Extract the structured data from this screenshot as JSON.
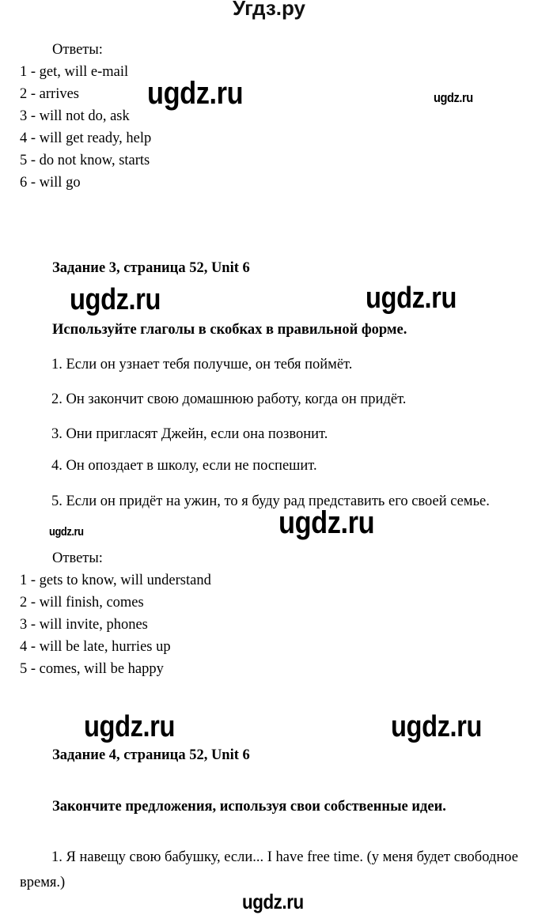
{
  "site": {
    "logo": "Угдз.ру",
    "watermark": "ugdz.ru"
  },
  "answers_block_1": {
    "title": "Ответы:",
    "lines": [
      "1 - get, will e-mail",
      "2 - arrives",
      "3 - will not do, ask",
      "4 - will get ready, help",
      "5 - do not know, starts",
      "6 - will go"
    ]
  },
  "task3": {
    "heading": "Задание 3, страница 52, Unit 6",
    "instruction": "Используйте глаголы в скобках в правильной форме.",
    "sentences": [
      "1. Если он узнает тебя получше, он тебя поймёт.",
      "2. Он закончит свою домашнюю работу, когда он придёт.",
      "3. Они пригласят Джейн, если она позвонит.",
      "4. Он опоздает в школу, если не поспешит.",
      "5. Если он придёт на ужин, то я буду рад представить его своей семье."
    ],
    "answers_title": "Ответы:",
    "answers": [
      "1 - gets to know, will understand",
      "2 - will finish, comes",
      "3 - will invite, phones",
      "4 - will be late, hurries up",
      "5 - comes, will be happy"
    ]
  },
  "task4": {
    "heading": "Задание 4, страница 52, Unit 6",
    "instruction": "Закончите предложения, используя свои собственные идеи.",
    "sentences": [
      "1. Я навещу свою бабушку, если... I have free time. (у меня будет свободное время.)"
    ]
  }
}
